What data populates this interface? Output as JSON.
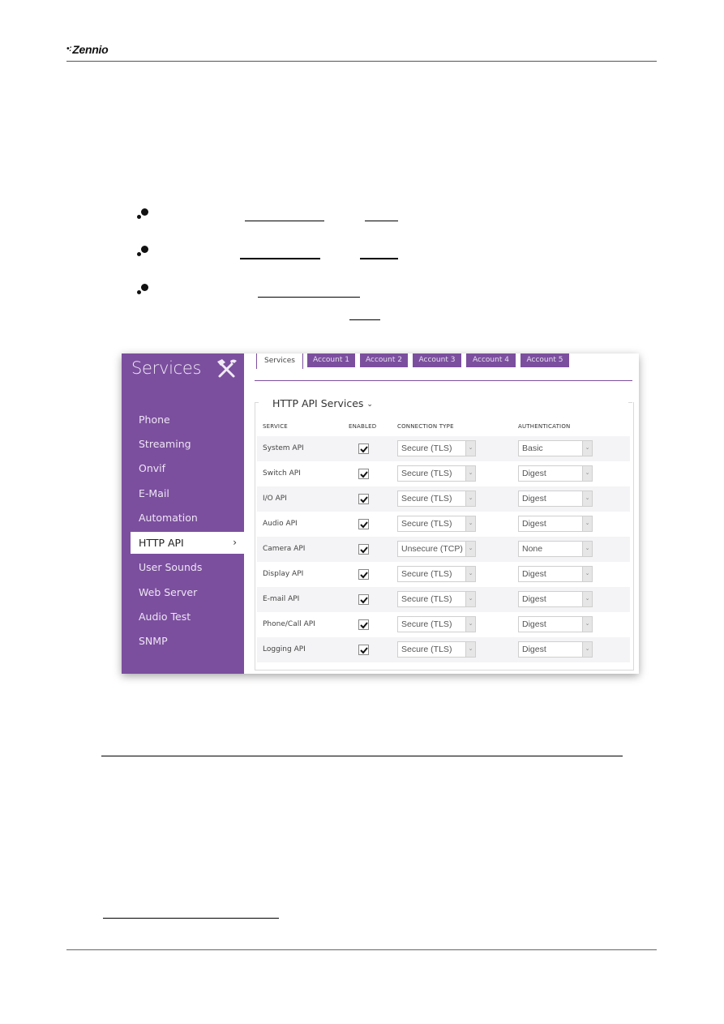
{
  "header": {
    "logo_text": "Zennio",
    "logo_dots": "•:"
  },
  "screenshot": {
    "sidebar": {
      "title": "Services",
      "title_icon": "tools-icon",
      "items": [
        {
          "label": "Phone",
          "active": false
        },
        {
          "label": "Streaming",
          "active": false
        },
        {
          "label": "Onvif",
          "active": false
        },
        {
          "label": "E-Mail",
          "active": false
        },
        {
          "label": "Automation",
          "active": false
        },
        {
          "label": "HTTP API",
          "active": true
        },
        {
          "label": "User Sounds",
          "active": false
        },
        {
          "label": "Web Server",
          "active": false
        },
        {
          "label": "Audio Test",
          "active": false
        },
        {
          "label": "SNMP",
          "active": false
        }
      ],
      "active_chevron": "›"
    },
    "tabs": [
      {
        "label": "Services",
        "active": true
      },
      {
        "label": "Account 1",
        "active": false
      },
      {
        "label": "Account 2",
        "active": false
      },
      {
        "label": "Account 3",
        "active": false
      },
      {
        "label": "Account 4",
        "active": false
      },
      {
        "label": "Account 5",
        "active": false
      }
    ],
    "section": {
      "title": "HTTP API Services",
      "caret": "⌄"
    },
    "table": {
      "headers": {
        "service": "SERVICE",
        "enabled": "ENABLED",
        "connection_type": "CONNECTION TYPE",
        "authentication": "AUTHENTICATION"
      },
      "rows": [
        {
          "service": "System API",
          "enabled": true,
          "connection_type": "Secure (TLS)",
          "authentication": "Basic"
        },
        {
          "service": "Switch API",
          "enabled": true,
          "connection_type": "Secure (TLS)",
          "authentication": "Digest"
        },
        {
          "service": "I/O API",
          "enabled": true,
          "connection_type": "Secure (TLS)",
          "authentication": "Digest"
        },
        {
          "service": "Audio API",
          "enabled": true,
          "connection_type": "Secure (TLS)",
          "authentication": "Digest"
        },
        {
          "service": "Camera API",
          "enabled": true,
          "connection_type": "Unsecure (TCP)",
          "authentication": "None"
        },
        {
          "service": "Display API",
          "enabled": true,
          "connection_type": "Secure (TLS)",
          "authentication": "Digest"
        },
        {
          "service": "E-mail API",
          "enabled": true,
          "connection_type": "Secure (TLS)",
          "authentication": "Digest"
        },
        {
          "service": "Phone/Call API",
          "enabled": true,
          "connection_type": "Secure (TLS)",
          "authentication": "Digest"
        },
        {
          "service": "Logging API",
          "enabled": true,
          "connection_type": "Secure (TLS)",
          "authentication": "Digest"
        }
      ]
    }
  },
  "colors": {
    "sidebar_purple": "#7b4f9e",
    "sidebar_text": "#efe5f5",
    "row_alt": "#f4f4f6"
  }
}
